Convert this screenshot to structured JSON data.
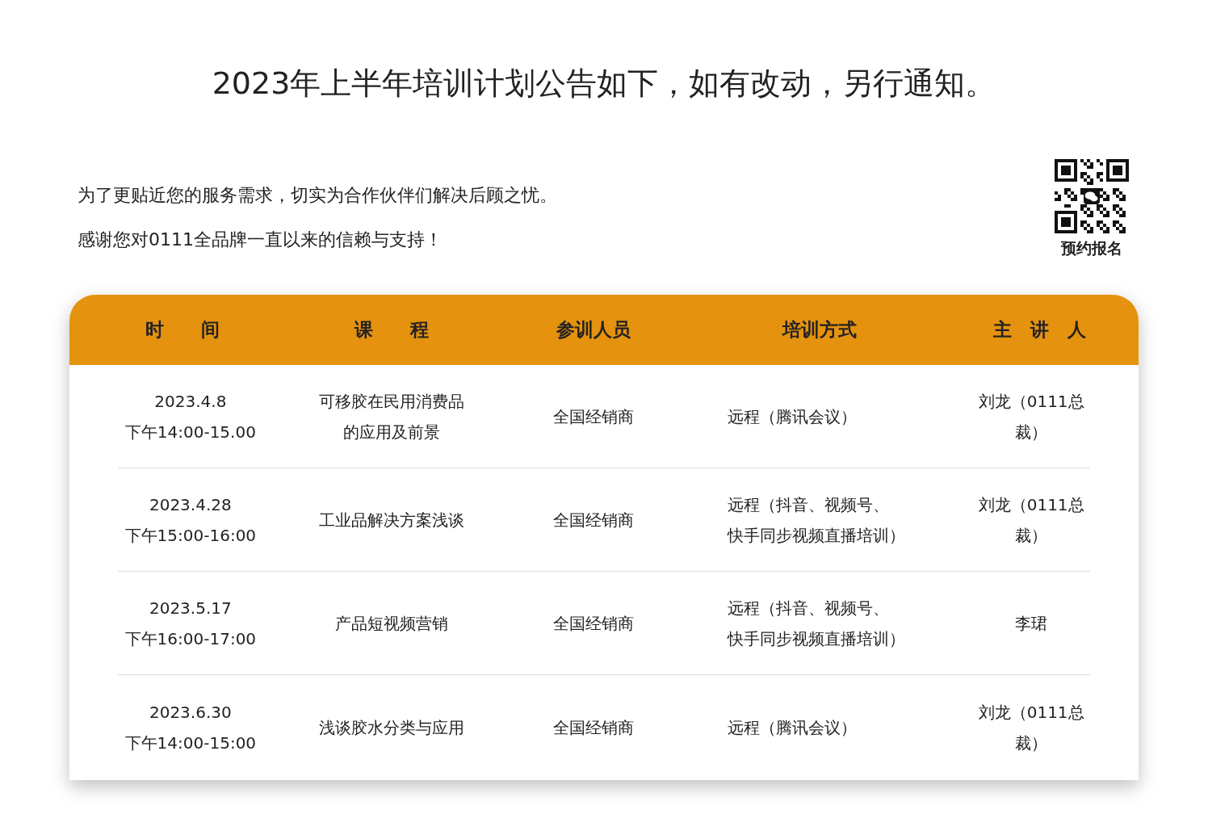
{
  "title": "2023年上半年培训计划公告如下，如有改动，另行通知。",
  "intro": [
    "为了更贴近您的服务需求，切实为合作伙伴们解决后顾之忧。",
    "感谢您对0111全品牌一直以来的信赖与支持！"
  ],
  "qr": {
    "label": "预约报名"
  },
  "table": {
    "columns": [
      "时　　间",
      "课　　程",
      "参训人员",
      "培训方式",
      "主　讲　人"
    ],
    "rows": [
      [
        [
          "2023.4.8",
          "下午14:00-15.00"
        ],
        [
          "可移胶在民用消费品",
          "的应用及前景"
        ],
        [
          "全国经销商"
        ],
        [
          "远程（腾讯会议）"
        ],
        [
          "刘龙（0111总裁）"
        ]
      ],
      [
        [
          "2023.4.28",
          "下午15:00-16:00"
        ],
        [
          "工业品解决方案浅谈"
        ],
        [
          "全国经销商"
        ],
        [
          "远程（抖音、视频号、",
          "快手同步视频直播培训）"
        ],
        [
          "刘龙（0111总裁）"
        ]
      ],
      [
        [
          "2023.5.17",
          "下午16:00-17:00"
        ],
        [
          "产品短视频营销"
        ],
        [
          "全国经销商"
        ],
        [
          "远程（抖音、视频号、",
          "快手同步视频直播培训）"
        ],
        [
          "李珺"
        ]
      ],
      [
        [
          "2023.6.30",
          "下午14:00-15:00"
        ],
        [
          "浅谈胶水分类与应用"
        ],
        [
          "全国经销商"
        ],
        [
          "远程（腾讯会议）"
        ],
        [
          "刘龙（0111总裁）"
        ]
      ]
    ]
  }
}
